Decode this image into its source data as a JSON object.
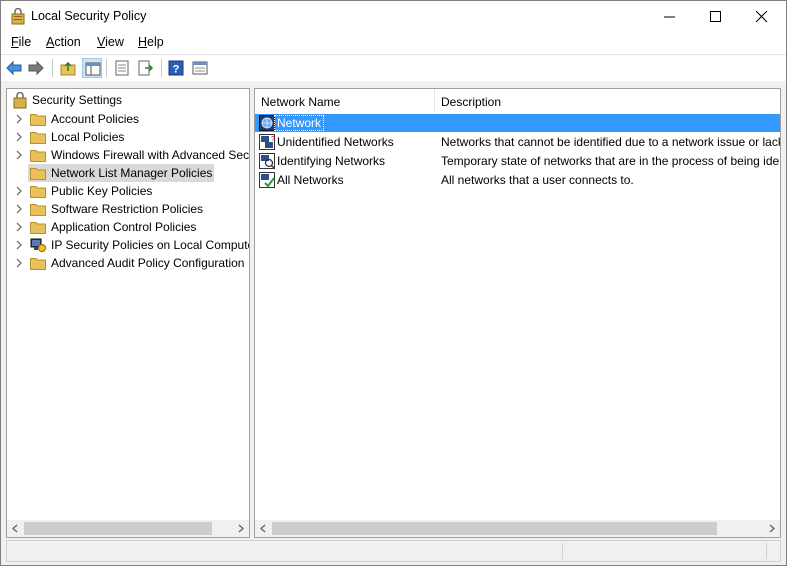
{
  "window": {
    "title": "Local Security Policy"
  },
  "menu": [
    {
      "key": "F",
      "rest": "ile"
    },
    {
      "key": "A",
      "rest": "ction"
    },
    {
      "key": "V",
      "rest": "iew"
    },
    {
      "key": "H",
      "rest": "elp"
    }
  ],
  "toolbar": {
    "buttons": [
      "back-icon",
      "forward-icon",
      "up-folder-icon",
      "show-hide-tree-icon",
      "properties-icon",
      "export-list-icon",
      "help-icon",
      "console-tree-icon"
    ]
  },
  "tree": {
    "root": "Security Settings",
    "items": [
      {
        "label": "Account Policies",
        "expandable": true
      },
      {
        "label": "Local Policies",
        "expandable": true
      },
      {
        "label": "Windows Firewall with Advanced Security",
        "expandable": true
      },
      {
        "label": "Network List Manager Policies",
        "expandable": false,
        "selected": true
      },
      {
        "label": "Public Key Policies",
        "expandable": true
      },
      {
        "label": "Software Restriction Policies",
        "expandable": true
      },
      {
        "label": "Application Control Policies",
        "expandable": true
      },
      {
        "label": "IP Security Policies on Local Computer",
        "expandable": true
      },
      {
        "label": "Advanced Audit Policy Configuration",
        "expandable": true
      }
    ]
  },
  "list": {
    "columns": [
      "Network Name",
      "Description"
    ],
    "rows": [
      {
        "name": "Network",
        "description": "",
        "icon": "network-icon",
        "selected": true
      },
      {
        "name": "Unidentified Networks",
        "description": "Networks that cannot be identified due to a network issue or lack of identifiable characteristics.",
        "icon": "unidentified-network-icon"
      },
      {
        "name": "Identifying Networks",
        "description": "Temporary state of networks that are in the process of being identified.",
        "icon": "identifying-network-icon"
      },
      {
        "name": "All Networks",
        "description": "All networks that a user connects to.",
        "icon": "all-networks-icon"
      }
    ]
  },
  "colors": {
    "selection": "#3399ff",
    "tree_selection": "#d9d9d9",
    "folder": "#e8c15a"
  }
}
